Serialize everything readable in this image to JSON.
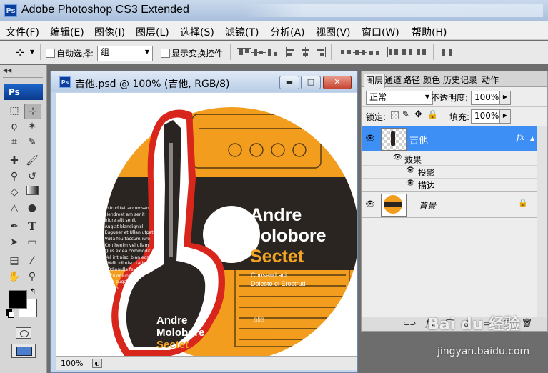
{
  "app": {
    "title": "Adobe Photoshop CS3 Extended",
    "logo": "Ps"
  },
  "menu": [
    "文件(F)",
    "编辑(E)",
    "图像(I)",
    "图层(L)",
    "选择(S)",
    "滤镜(T)",
    "分析(A)",
    "视图(V)",
    "窗口(W)",
    "帮助(H)"
  ],
  "options": {
    "auto_select_label": "自动选择:",
    "auto_select_value": "组",
    "show_transform_label": "显示变换控件"
  },
  "toolbox": {
    "badge": "Ps"
  },
  "document": {
    "title": "吉他.psd @ 100% (吉他, RGB/8)",
    "zoom": "100%",
    "window_buttons": {
      "minimize": "▬",
      "maximize": "□",
      "close": "✕"
    },
    "artwork": {
      "band_top": "Andre",
      "band_mid": "Molobore",
      "band_accent": "Sectet",
      "sub1": "Consend aci",
      "sub2": "Dolesto el Erostrud",
      "tracks": [
        "1. Estrud tet accumsan",
        "2. Hendreet am senit",
        "3. Iriure alit senit",
        "4. Augiat blandignisl",
        "5. Eugueer et Ullan utpatin",
        "6. Vulla feu faccum iure",
        "7. Con henim vel ullam",
        "8. Quis ex ea commodit",
        "9. Vel irit nisci blan eoss",
        "10. Velit iril nisci tatis",
        "11. Odionulla fe",
        "12. Acil doluptat",
        "14. Ero eugait",
        "15. Ullaor"
      ],
      "guitar_band": [
        "Andre",
        "Molobore",
        "Sectet"
      ],
      "logo_text": "alis"
    }
  },
  "panel": {
    "tabs": [
      "图层",
      "通道",
      "路径",
      "颜色",
      "历史记录",
      "动作"
    ],
    "blend_mode": "正常",
    "opacity_label": "不透明度:",
    "opacity_value": "100%",
    "lock_label": "锁定:",
    "fill_label": "填充:",
    "fill_value": "100%",
    "layers": [
      {
        "name": "吉他",
        "fx": "fx",
        "selected": true
      },
      {
        "name": "背景",
        "selected": false
      }
    ],
    "effects_label": "效果",
    "effects": [
      "投影",
      "描边"
    ]
  },
  "watermark": {
    "text": "Bai du 经验",
    "url": "jingyan.baidu.com"
  },
  "colors": {
    "selected_layer": "#3d8ef5",
    "disc_orange": "#f29d1e",
    "disc_band": "#2b2522",
    "accent": "#f2a422",
    "outline_red": "#d8261c"
  }
}
